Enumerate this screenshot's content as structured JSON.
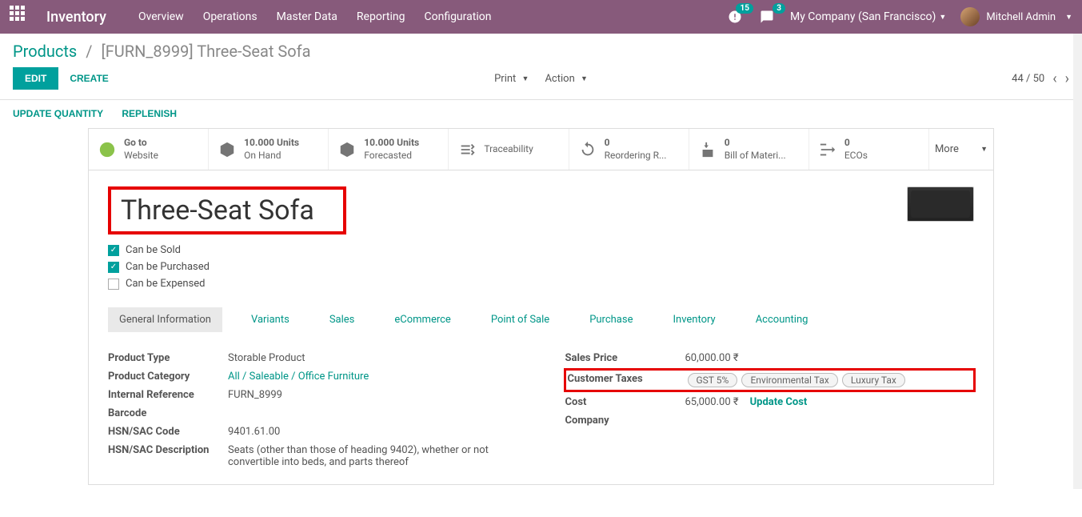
{
  "nav": {
    "brand": "Inventory",
    "menu": [
      "Overview",
      "Operations",
      "Master Data",
      "Reporting",
      "Configuration"
    ],
    "badges": {
      "activity": "15",
      "chat": "3"
    },
    "company": "My Company (San Francisco)",
    "user": "Mitchell Admin"
  },
  "breadcrumb": {
    "root": "Products",
    "current": "[FURN_8999] Three-Seat Sofa"
  },
  "buttons": {
    "edit": "EDIT",
    "create": "CREATE",
    "print": "Print",
    "action": "Action",
    "pager": "44 / 50",
    "upd_qty": "UPDATE QUANTITY",
    "replenish": "REPLENISH",
    "more": "More"
  },
  "stats": [
    {
      "top": "Go to",
      "bot": "Website"
    },
    {
      "top": "10.000 Units",
      "bot": "On Hand"
    },
    {
      "top": "10.000 Units",
      "bot": "Forecasted"
    },
    {
      "top": "",
      "bot": "Traceability"
    },
    {
      "top": "0",
      "bot": "Reordering R..."
    },
    {
      "top": "0",
      "bot": "Bill of Materi..."
    },
    {
      "top": "0",
      "bot": "ECOs"
    }
  ],
  "product": {
    "name": "Three-Seat Sofa",
    "can_sold": "Can be Sold",
    "can_purch": "Can be Purchased",
    "can_exp": "Can be Expensed"
  },
  "tabs": [
    "General Information",
    "Variants",
    "Sales",
    "eCommerce",
    "Point of Sale",
    "Purchase",
    "Inventory",
    "Accounting"
  ],
  "left_fields": {
    "product_type": {
      "l": "Product Type",
      "v": "Storable Product"
    },
    "category": {
      "l": "Product Category",
      "v": "All / Saleable / Office Furniture"
    },
    "intref": {
      "l": "Internal Reference",
      "v": "FURN_8999"
    },
    "barcode": {
      "l": "Barcode",
      "v": ""
    },
    "hsn": {
      "l": "HSN/SAC Code",
      "v": "9401.61.00"
    },
    "hsnd": {
      "l": "HSN/SAC Description",
      "v": "Seats (other than those of heading 9402), whether or not convertible into beds, and parts thereof"
    }
  },
  "right_fields": {
    "sales_price": {
      "l": "Sales Price",
      "v": "60,000.00 ₹"
    },
    "cust_tax": {
      "l": "Customer Taxes"
    },
    "cost": {
      "l": "Cost",
      "v": "65,000.00 ₹",
      "link": "Update Cost"
    },
    "company": {
      "l": "Company",
      "v": ""
    }
  },
  "taxes": [
    "GST 5%",
    "Environmental Tax",
    "Luxury Tax"
  ]
}
